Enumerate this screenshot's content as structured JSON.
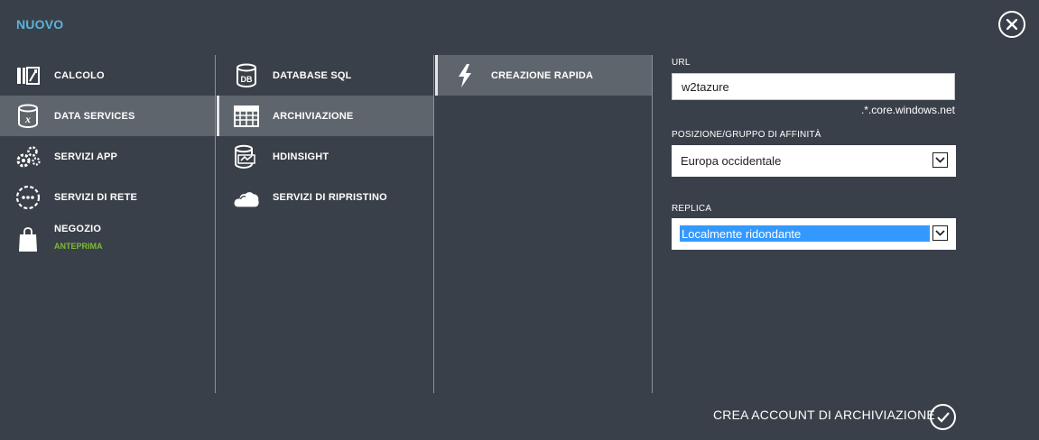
{
  "header": {
    "title": "NUOVO"
  },
  "categories": [
    {
      "label": "CALCOLO",
      "icon": "compute-icon"
    },
    {
      "label": "DATA SERVICES",
      "icon": "data-services-icon"
    },
    {
      "label": "SERVIZI APP",
      "icon": "gears-icon"
    },
    {
      "label": "SERVIZI DI RETE",
      "icon": "network-icon"
    },
    {
      "label": "NEGOZIO",
      "sublabel": "ANTEPRIMA",
      "icon": "shopping-bag-icon"
    }
  ],
  "services": [
    {
      "label": "DATABASE SQL",
      "icon": "database-icon"
    },
    {
      "label": "ARCHIVIAZIONE",
      "icon": "storage-grid-icon"
    },
    {
      "label": "HDINSIGHT",
      "icon": "hdinsight-icon"
    },
    {
      "label": "SERVIZI DI RIPRISTINO",
      "icon": "cloud-icon"
    }
  ],
  "create_options": [
    {
      "label": "CREAZIONE RAPIDA",
      "icon": "lightning-icon"
    }
  ],
  "form": {
    "url_label": "URL",
    "url_value": "w2tazure",
    "url_suffix": ".*.core.windows.net",
    "location_label": "POSIZIONE/GRUPPO DI AFFINITÀ",
    "location_value": "Europa occidentale",
    "replica_label": "REPLICA",
    "replica_value": "Localmente ridondante"
  },
  "footer": {
    "create_label": "CREA ACCOUNT DI ARCHIVIAZIONE"
  },
  "colors": {
    "background": "#3a4049",
    "selected": "#5f656d",
    "title": "#59b4d9",
    "preview": "#7cbc36",
    "highlight": "#3399ff"
  }
}
